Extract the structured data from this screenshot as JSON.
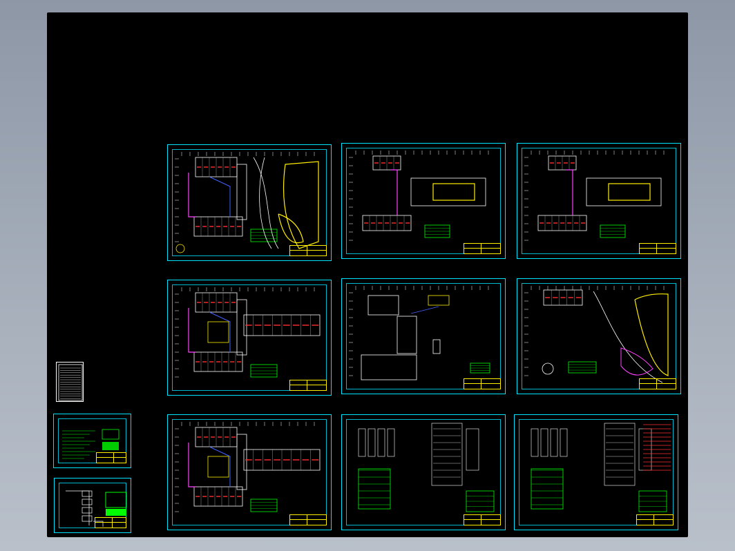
{
  "colors": {
    "background_outer": "#9aa3b0",
    "canvas": "#000000",
    "frame": "#00e5ff",
    "wall": "#ffffff",
    "green_table": "#00ff00",
    "yellow": "#ffee00",
    "red": "#ff3030",
    "magenta": "#ff40ff",
    "blue": "#4060ff"
  },
  "sheets": [
    {
      "id": "floor-plan-site-1",
      "kind": "site-plan"
    },
    {
      "id": "floor-plan-2",
      "kind": "plan-wide"
    },
    {
      "id": "floor-plan-3",
      "kind": "plan-wide"
    },
    {
      "id": "floor-plan-4",
      "kind": "plan-double"
    },
    {
      "id": "floor-plan-5",
      "kind": "plan-roof"
    },
    {
      "id": "floor-plan-site-6",
      "kind": "site-plan"
    },
    {
      "id": "floor-plan-7",
      "kind": "plan-double"
    },
    {
      "id": "schematic-8",
      "kind": "schematic"
    },
    {
      "id": "schematic-9",
      "kind": "schematic"
    },
    {
      "id": "index-sheet",
      "kind": "index"
    },
    {
      "id": "notes-sheet",
      "kind": "notes"
    },
    {
      "id": "riser-sheet",
      "kind": "riser"
    }
  ]
}
